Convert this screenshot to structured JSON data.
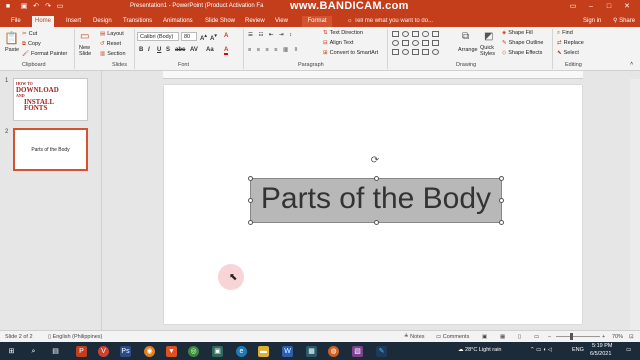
{
  "window": {
    "title": "Presentation1 - PowerPoint (Product Activation Fa",
    "watermark": "www.BANDICAM.com",
    "tell_me": "Tell me what you want to do...",
    "sign_in": "Sign in",
    "share": "Share"
  },
  "tabs": [
    "File",
    "Home",
    "Insert",
    "Design",
    "Transitions",
    "Animations",
    "Slide Show",
    "Review",
    "View",
    "Format"
  ],
  "ribbon": {
    "clipboard": {
      "label": "Clipboard",
      "paste": "Paste",
      "cut": "Cut",
      "copy": "Copy",
      "format_painter": "Format Painter"
    },
    "slides": {
      "label": "Slides",
      "new_slide": "New Slide",
      "layout": "Layout",
      "reset": "Reset",
      "section": "Section"
    },
    "font": {
      "label": "Font",
      "name": "Calibri (Body)",
      "size": "80"
    },
    "paragraph": {
      "label": "Paragraph",
      "text_direction": "Text Direction",
      "align_text": "Align Text",
      "convert": "Convert to SmartArt"
    },
    "drawing": {
      "label": "Drawing",
      "arrange": "Arrange",
      "quick_styles": "Quick Styles",
      "shape_fill": "Shape Fill",
      "shape_outline": "Shape Outline",
      "shape_effects": "Shape Effects"
    },
    "editing": {
      "label": "Editing",
      "find": "Find",
      "replace": "Replace",
      "select": "Select"
    }
  },
  "slides": [
    {
      "num": "1",
      "lines": [
        "HOW TO",
        "DOWNLOAD",
        "AND",
        "INSTALL",
        "FONTS"
      ]
    },
    {
      "num": "2",
      "text": "Parts of the Body"
    }
  ],
  "slide": {
    "title": "Parts of the Body"
  },
  "status": {
    "slide_of": "Slide 2 of 2",
    "language": "English (Philippines)",
    "notes": "Notes",
    "comments": "Comments",
    "zoom": "70%"
  },
  "taskbar": {
    "weather": "28°C  Light rain",
    "lang": "ENG",
    "time": "5:19 PM",
    "date": "6/5/2021"
  }
}
